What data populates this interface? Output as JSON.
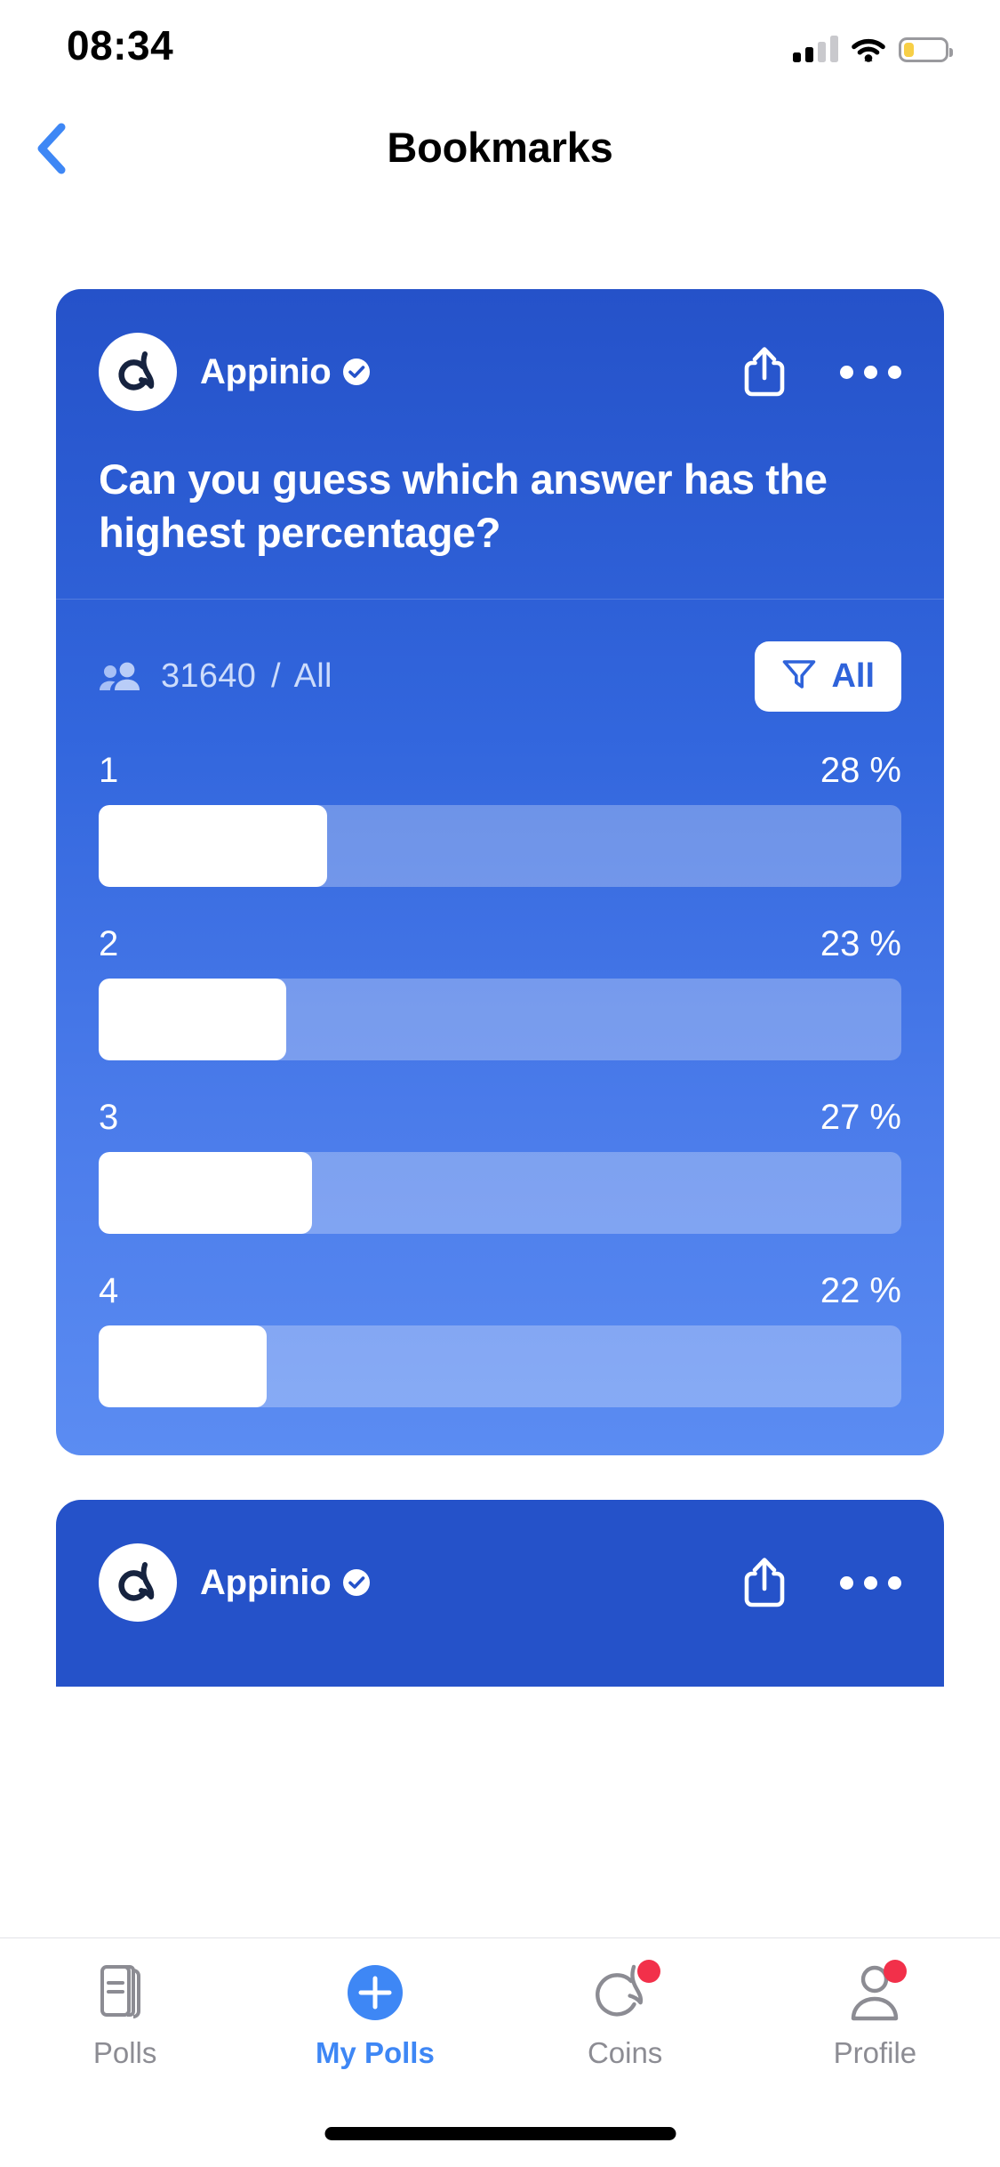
{
  "status_bar": {
    "time": "08:34",
    "signal_bars_total": 4,
    "signal_bars_active": 2,
    "wifi": "wifi-icon",
    "battery_level_pct": 25,
    "battery_color": "#f7cf46"
  },
  "nav": {
    "back_icon": "chevron-left-icon",
    "title": "Bookmarks",
    "accent_color": "#3e87f5"
  },
  "poll_card": {
    "brand": "Appinio",
    "verified_icon": "verified-badge-icon",
    "avatar_icon": "appinio-logo-icon",
    "share_icon": "share-icon",
    "more_icon": "more-horizontal-icon",
    "question": "Can you guess which answer has the highest percentage?",
    "respondents": "31640",
    "separator": "/",
    "audience": "All",
    "people_icon": "people-icon",
    "filter": {
      "icon": "filter-funnel-icon",
      "label": "All"
    },
    "card_gradient_from": "#2552c9",
    "card_gradient_to": "#5b8cf2"
  },
  "chart_data": {
    "type": "bar",
    "title": "Can you guess which answer has the highest percentage?",
    "categories": [
      "1",
      "2",
      "3",
      "4"
    ],
    "values": [
      28,
      23,
      27,
      22
    ],
    "value_labels": [
      "28 %",
      "23 %",
      "27 %",
      "22 %"
    ],
    "bar_fill_fractions": [
      0.285,
      0.234,
      0.266,
      0.209
    ],
    "xlabel": "",
    "ylabel": "",
    "ylim": [
      0,
      100
    ],
    "grid": false,
    "legend": false,
    "orientation": "horizontal",
    "total_respondents": 31640,
    "audience_filter": "All",
    "bar_fill_color": "#ffffff",
    "bar_track_color": "rgba(255,255,255,0.28)"
  },
  "peek_card": {
    "brand": "Appinio",
    "verified_icon": "verified-badge-icon",
    "share_icon": "share-icon",
    "more_icon": "more-horizontal-icon"
  },
  "tabbar": {
    "items": [
      {
        "label": "Polls",
        "icon": "polls-icon",
        "active": false,
        "badge": false
      },
      {
        "label": "My Polls",
        "icon": "plus-circle-icon",
        "active": true,
        "badge": false
      },
      {
        "label": "Coins",
        "icon": "coins-icon",
        "active": false,
        "badge": true
      },
      {
        "label": "Profile",
        "icon": "profile-icon",
        "active": false,
        "badge": true
      }
    ],
    "active_color": "#3e87f5",
    "inactive_color": "#8c8c93",
    "badge_color": "#f2304a"
  }
}
